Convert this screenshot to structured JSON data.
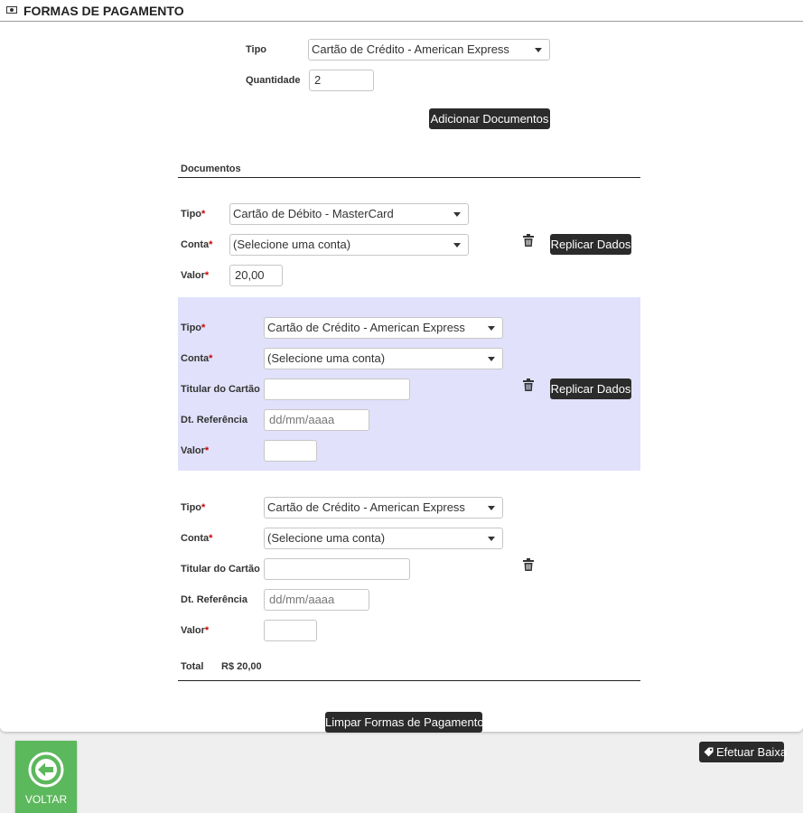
{
  "header": {
    "title": "FORMAS DE PAGAMENTO",
    "icon": "money-icon"
  },
  "top_form": {
    "tipo_label": "Tipo",
    "tipo_value": "Cartão de Crédito - American Express",
    "quantidade_label": "Quantidade",
    "quantidade_value": "2",
    "add_button": "Adicionar Documentos"
  },
  "documents_section": {
    "title": "Documentos"
  },
  "documents": [
    {
      "tipo_label": "Tipo",
      "tipo_value": "Cartão de Débito - MasterCard",
      "conta_label": "Conta",
      "conta_value": "(Selecione uma conta)",
      "valor_label": "Valor",
      "valor_value": "20,00",
      "replicate_button": "Replicar Dados"
    },
    {
      "tipo_label": "Tipo",
      "tipo_value": "Cartão de Crédito - American Express",
      "conta_label": "Conta",
      "conta_value": "(Selecione uma conta)",
      "titular_label": "Titular do Cartão",
      "titular_value": "",
      "dt_label": "Dt. Referência",
      "dt_placeholder": "dd/mm/aaaa",
      "valor_label": "Valor",
      "valor_value": "",
      "replicate_button": "Replicar Dados"
    },
    {
      "tipo_label": "Tipo",
      "tipo_value": "Cartão de Crédito - American Express",
      "conta_label": "Conta",
      "conta_value": "(Selecione uma conta)",
      "titular_label": "Titular do Cartão",
      "titular_value": "",
      "dt_label": "Dt. Referência",
      "dt_placeholder": "dd/mm/aaaa",
      "valor_label": "Valor",
      "valor_value": ""
    }
  ],
  "total": {
    "label": "Total",
    "value": "R$ 20,00"
  },
  "clear_button": "Limpar Formas de Pagamento",
  "efetuar_button": "Efetuar Baixa",
  "voltar_button": "VOLTAR",
  "colors": {
    "highlight": "#e1e1fb",
    "button": "#2b2b2b",
    "voltar": "#5cb85c",
    "required": "#cc0000"
  }
}
